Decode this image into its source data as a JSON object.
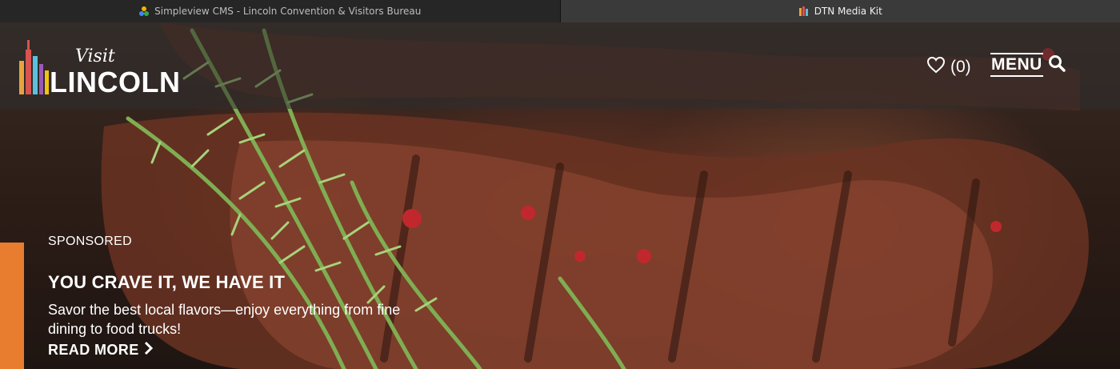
{
  "browser": {
    "tabs": [
      {
        "title": "Simpleview CMS - Lincoln Convention & Visitors Bureau",
        "icon": "simpleview-icon",
        "active": false
      },
      {
        "title": "DTN Media Kit",
        "icon": "dtn-icon",
        "active": true
      }
    ]
  },
  "site": {
    "logo": {
      "visit": "Visit",
      "name": "LINCOLN"
    },
    "favorites_count": "(0)",
    "menu_label": "MENU"
  },
  "hero": {
    "tag": "SPONSORED",
    "headline": "YOU CRAVE IT, WE HAVE IT",
    "description": "Savor the best local flavors—enjoy everything from fine dining to food trucks!",
    "cta": "READ MORE",
    "accent_color": "#e87d2f",
    "image_subject": "grilled steak with rosemary"
  }
}
